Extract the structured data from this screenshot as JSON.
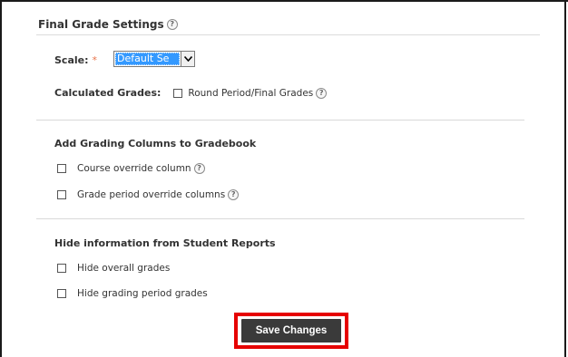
{
  "section": {
    "title": "Final Grade Settings",
    "help_glyph": "?"
  },
  "scale": {
    "label": "Scale:",
    "required_mark": "*",
    "selected_value": "Default Se"
  },
  "calculated_grades": {
    "label": "Calculated Grades:",
    "checkbox_label": "Round Period/Final Grades",
    "checked": false
  },
  "grading_columns": {
    "title": "Add Grading Columns to Gradebook",
    "options": [
      {
        "label": "Course override column",
        "checked": false
      },
      {
        "label": "Grade period override columns",
        "checked": false
      }
    ]
  },
  "hide_info": {
    "title": "Hide information from Student Reports",
    "options": [
      {
        "label": "Hide overall grades",
        "checked": false
      },
      {
        "label": "Hide grading period grades",
        "checked": false
      }
    ]
  },
  "save_button": {
    "label": "Save Changes"
  },
  "colors": {
    "select_highlight": "#3399ff",
    "save_button_bg": "#3a3a3a",
    "highlight_box": "#e60000",
    "required": "#e8734a"
  }
}
